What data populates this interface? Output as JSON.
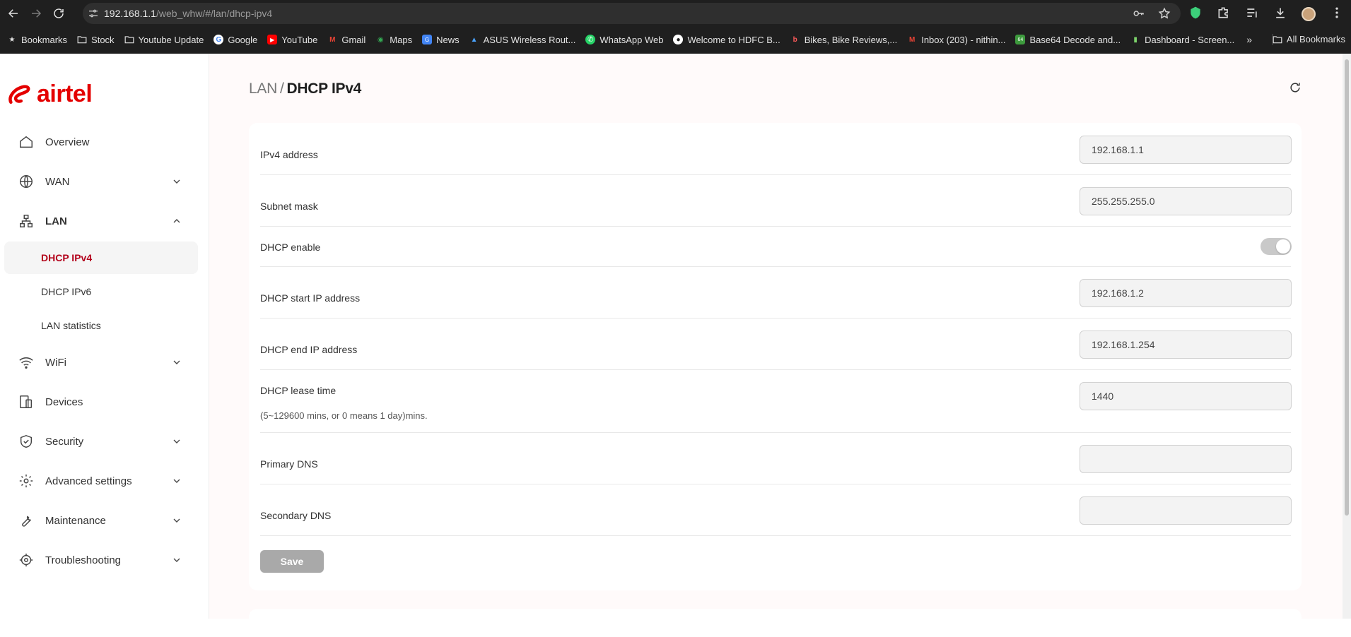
{
  "browser": {
    "url_host": "192.168.1.1",
    "url_path": "/web_whw/#/lan/dhcp-ipv4",
    "bookmarks": [
      {
        "label": "Bookmarks",
        "icon": "star-icon"
      },
      {
        "label": "Stock",
        "icon": "folder-icon"
      },
      {
        "label": "Youtube Update",
        "icon": "folder-icon"
      },
      {
        "label": "Google",
        "icon": "google-icon"
      },
      {
        "label": "YouTube",
        "icon": "youtube-icon"
      },
      {
        "label": "Gmail",
        "icon": "gmail-icon"
      },
      {
        "label": "Maps",
        "icon": "maps-icon"
      },
      {
        "label": "News",
        "icon": "news-icon"
      },
      {
        "label": "ASUS Wireless Rout...",
        "icon": "asus-icon"
      },
      {
        "label": "WhatsApp Web",
        "icon": "whatsapp-icon"
      },
      {
        "label": "Welcome to HDFC B...",
        "icon": "hdfc-icon"
      },
      {
        "label": "Bikes, Bike Reviews,...",
        "icon": "bikes-icon"
      },
      {
        "label": "Inbox (203) - nithin...",
        "icon": "gmail-icon"
      },
      {
        "label": "Base64 Decode and...",
        "icon": "base64-icon"
      },
      {
        "label": "Dashboard - Screen...",
        "icon": "dashboard-icon"
      }
    ],
    "more_label": "»",
    "all_bookmarks_label": "All Bookmarks"
  },
  "brand": {
    "name": "airtel",
    "color": "#e40000"
  },
  "sidebar": {
    "items": [
      {
        "label": "Overview",
        "icon": "home-icon"
      },
      {
        "label": "WAN",
        "icon": "globe-icon"
      },
      {
        "label": "LAN",
        "icon": "network-icon"
      },
      {
        "label": "WiFi",
        "icon": "wifi-icon"
      },
      {
        "label": "Devices",
        "icon": "devices-icon"
      },
      {
        "label": "Security",
        "icon": "shield-icon"
      },
      {
        "label": "Advanced settings",
        "icon": "gear-icon"
      },
      {
        "label": "Maintenance",
        "icon": "wrench-icon"
      },
      {
        "label": "Troubleshooting",
        "icon": "target-icon"
      }
    ],
    "lan_sub": [
      {
        "label": "DHCP IPv4",
        "active": true
      },
      {
        "label": "DHCP IPv6",
        "active": false
      },
      {
        "label": "LAN statistics",
        "active": false
      }
    ]
  },
  "page": {
    "breadcrumb_parent": "LAN",
    "breadcrumb_sep": "/",
    "title": "DHCP IPv4"
  },
  "form": {
    "ipv4_address": {
      "label": "IPv4 address",
      "value": "192.168.1.1"
    },
    "subnet_mask": {
      "label": "Subnet mask",
      "value": "255.255.255.0"
    },
    "dhcp_enable": {
      "label": "DHCP enable",
      "enabled": true
    },
    "dhcp_start": {
      "label": "DHCP start IP address",
      "value": "192.168.1.2"
    },
    "dhcp_end": {
      "label": "DHCP end IP address",
      "value": "192.168.1.254"
    },
    "lease_time": {
      "label": "DHCP lease time",
      "hint": "(5~129600 mins, or 0 means 1 day)mins.",
      "value": "1440"
    },
    "primary_dns": {
      "label": "Primary DNS",
      "value": ""
    },
    "secondary_dns": {
      "label": "Secondary DNS",
      "value": ""
    },
    "save_label": "Save"
  },
  "colors": {
    "active_text": "#b3001b",
    "save_disabled": "#a9a9a9"
  }
}
